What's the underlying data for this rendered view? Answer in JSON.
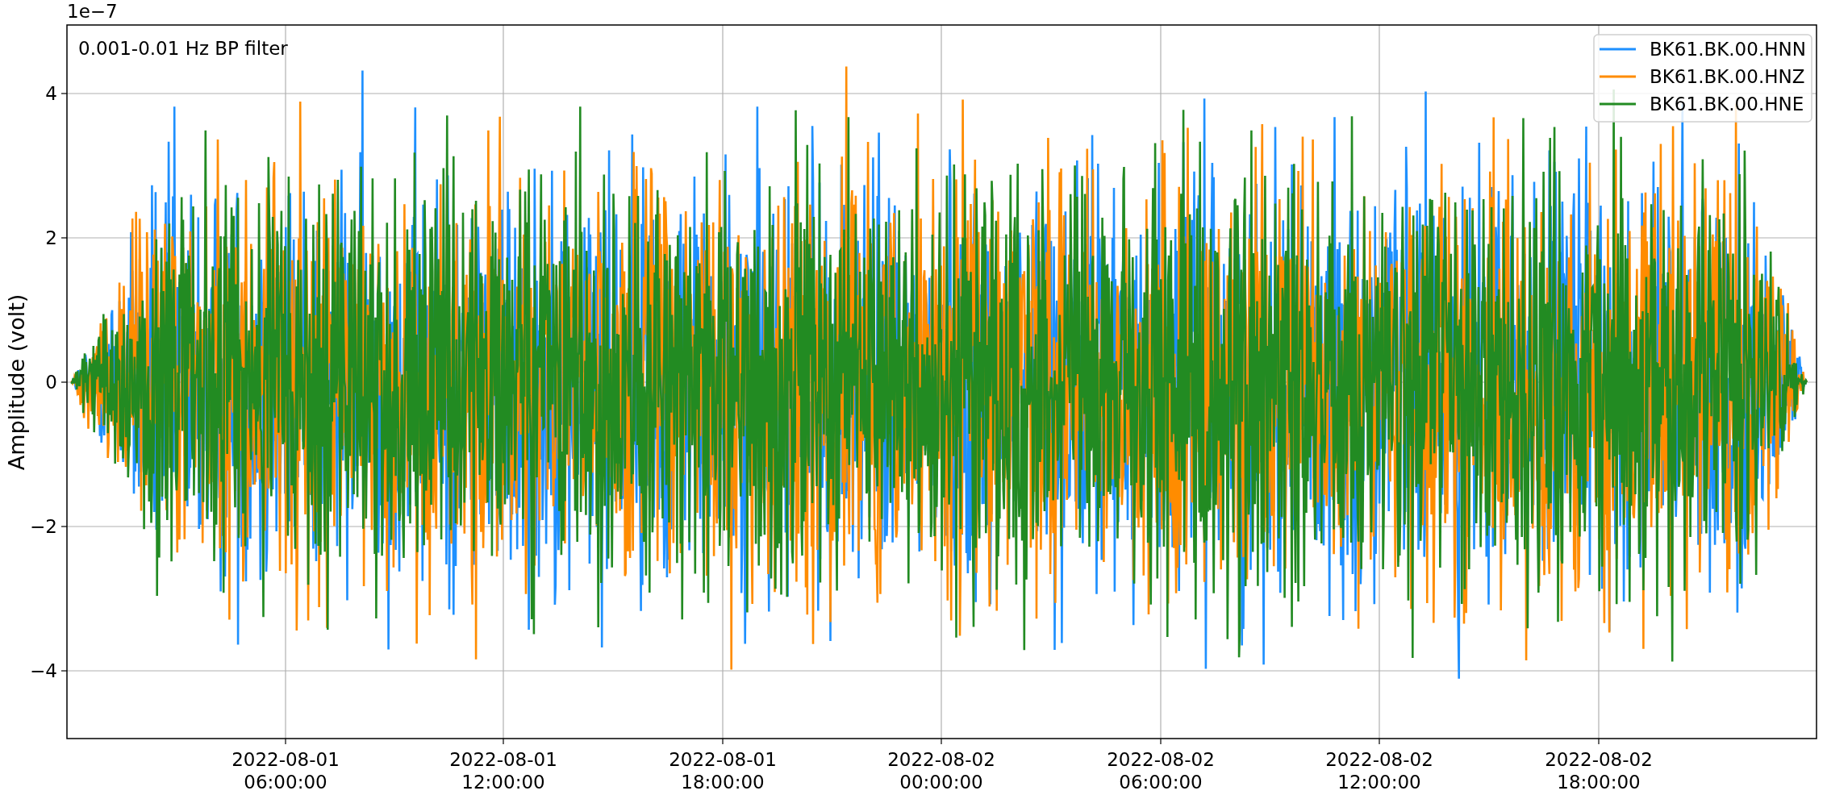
{
  "plot": {
    "exponent_label": "1e−7",
    "annotation": "0.001-0.01 Hz BP filter",
    "ylabel": "Amplitude (volt)",
    "yticks": [
      "4",
      "2",
      "0",
      "−2",
      "−4"
    ],
    "xticks": [
      {
        "date": "2022-08-01",
        "time": "06:00:00"
      },
      {
        "date": "2022-08-01",
        "time": "12:00:00"
      },
      {
        "date": "2022-08-01",
        "time": "18:00:00"
      },
      {
        "date": "2022-08-02",
        "time": "00:00:00"
      },
      {
        "date": "2022-08-02",
        "time": "06:00:00"
      },
      {
        "date": "2022-08-02",
        "time": "12:00:00"
      },
      {
        "date": "2022-08-02",
        "time": "18:00:00"
      }
    ],
    "legend": [
      {
        "label": "BK61.BK.00.HNN",
        "color": "#1e90ff"
      },
      {
        "label": "BK61.BK.00.HNZ",
        "color": "#ff8c00"
      },
      {
        "label": "BK61.BK.00.HNE",
        "color": "#228b22"
      }
    ]
  }
}
